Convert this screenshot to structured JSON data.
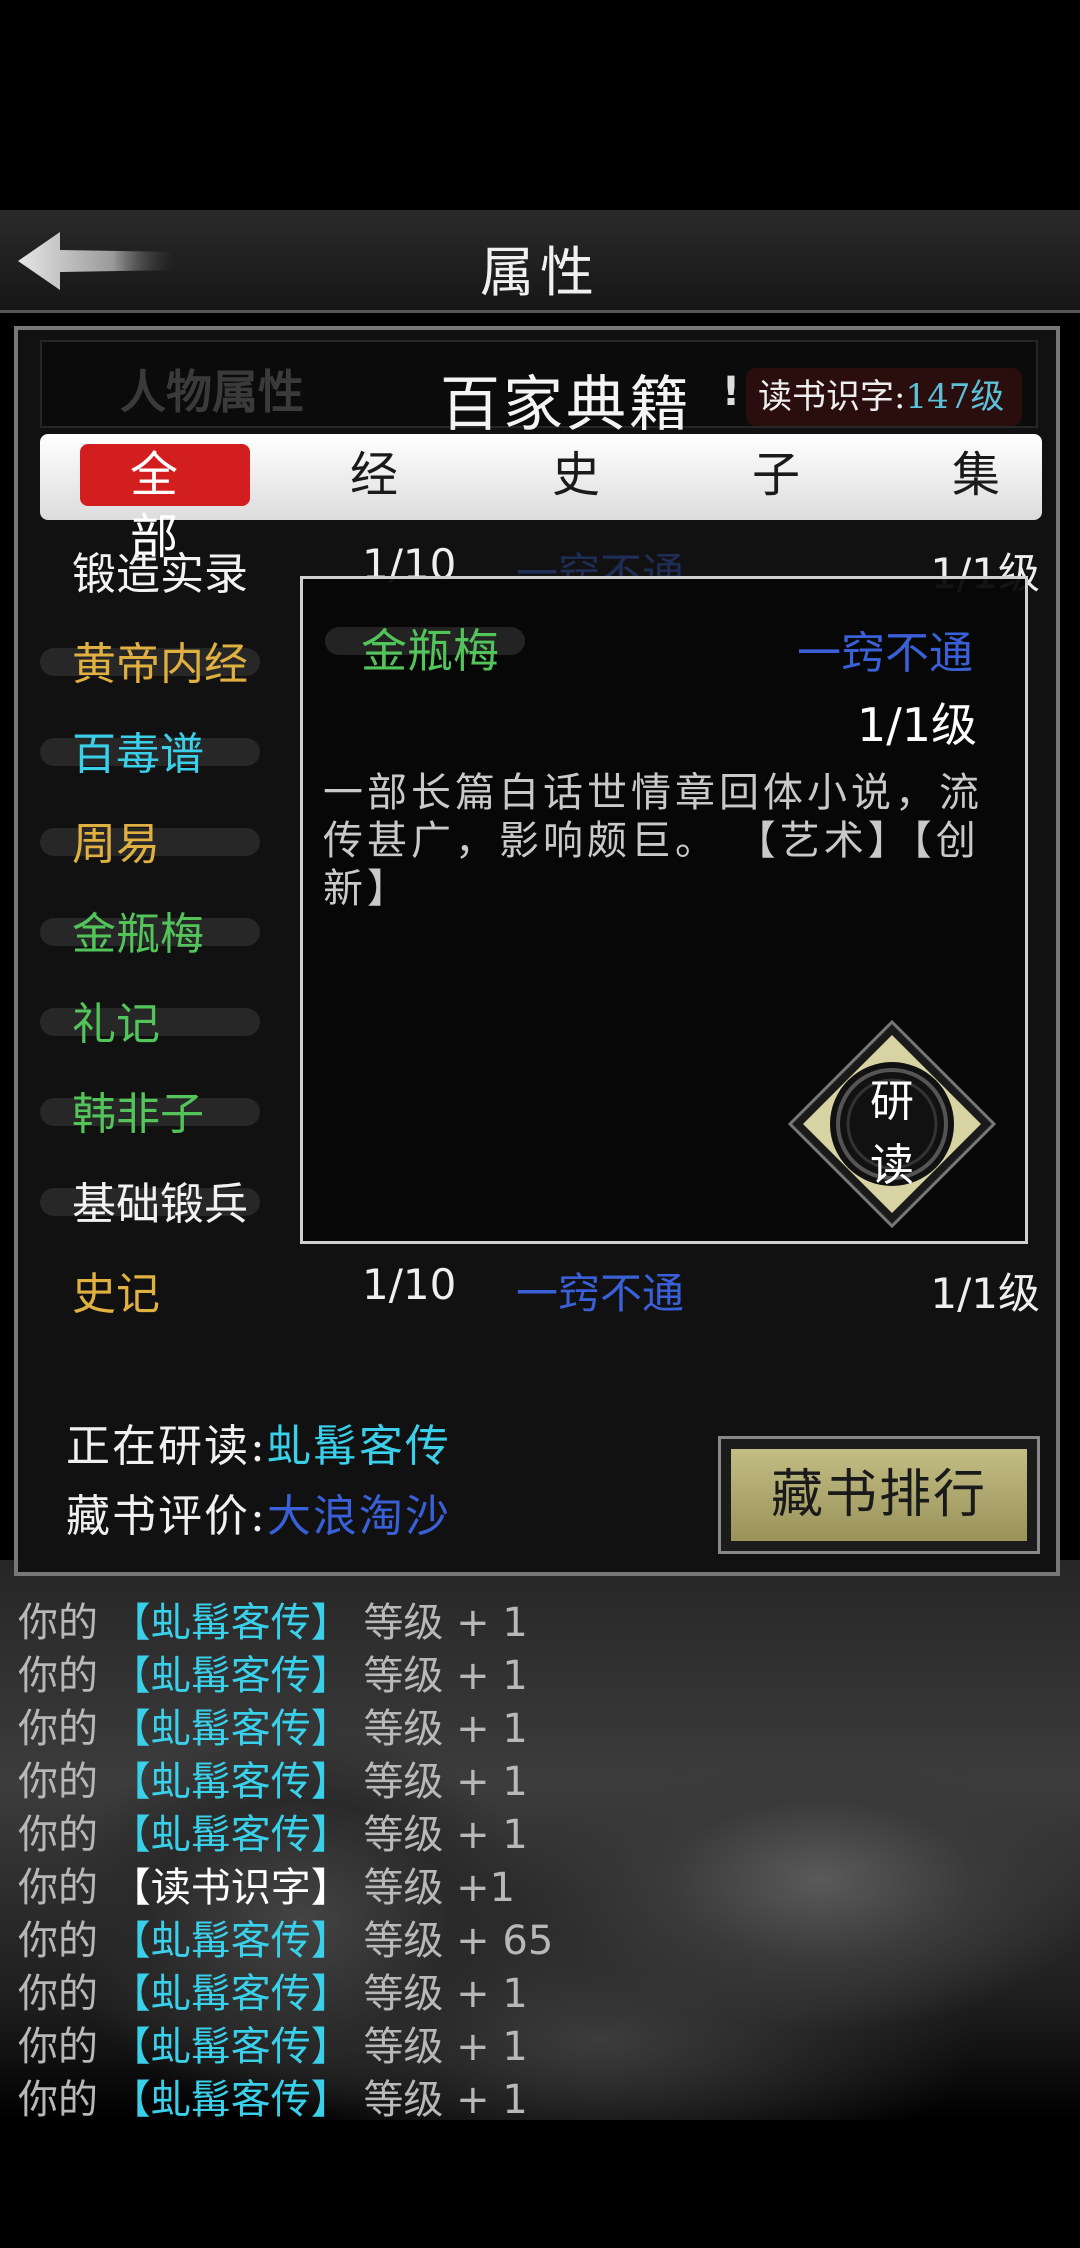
{
  "header": {
    "title": "属性",
    "back_icon": "back-arrow-icon"
  },
  "panel": {
    "bg_tab_label": "人物属性",
    "title": "百家典籍",
    "exclaim": "!",
    "reading_skill_label": "读书识字:",
    "reading_skill_value": "147级"
  },
  "tabs": [
    {
      "label": "全部",
      "active": true
    },
    {
      "label": "经"
    },
    {
      "label": "史"
    },
    {
      "label": "子"
    },
    {
      "label": "集"
    }
  ],
  "books": [
    {
      "name": "锻造实录",
      "color": "#f2f2f2",
      "progress": "1/10",
      "mastery": "一窍不通",
      "level": "1/1级"
    },
    {
      "name": "黄帝内经",
      "color": "#e0b040",
      "progress": "",
      "mastery": "",
      "level": ""
    },
    {
      "name": "百毒谱",
      "color": "#3ad0ea",
      "progress": "",
      "mastery": "",
      "level": ""
    },
    {
      "name": "周易",
      "color": "#e0b040",
      "progress": "",
      "mastery": "",
      "level": ""
    },
    {
      "name": "金瓶梅",
      "color": "#52c45a",
      "progress": "",
      "mastery": "",
      "level": ""
    },
    {
      "name": "礼记",
      "color": "#52c45a",
      "progress": "",
      "mastery": "",
      "level": ""
    },
    {
      "name": "韩非子",
      "color": "#52c45a",
      "progress": "",
      "mastery": "",
      "level": ""
    },
    {
      "name": "基础锻兵",
      "color": "#f2f2f2",
      "progress": "",
      "mastery": "",
      "level": ""
    },
    {
      "name": "史记",
      "color": "#e0b040",
      "progress": "1/10",
      "mastery": "一窍不通",
      "level": "1/1级"
    }
  ],
  "popup": {
    "name": "金瓶梅",
    "mastery": "一窍不通",
    "level": "1/1级",
    "description": "一部长篇白话世情章回体小说，流传甚广，影响颇巨。  【艺术】【创新】",
    "study_button_line1": "研",
    "study_button_line2": "读"
  },
  "status": {
    "studying_label": "正在研读:",
    "studying_value": "虬髯客传",
    "rating_label": "藏书评价:",
    "rating_value": "大浪淘沙"
  },
  "rank_button": "藏书排行",
  "log": [
    {
      "prefix": "你的",
      "book": "【虬髯客传】",
      "suffix": "等级 + 1"
    },
    {
      "prefix": "你的",
      "book": "【虬髯客传】",
      "suffix": "等级 + 1"
    },
    {
      "prefix": "你的",
      "book": "【虬髯客传】",
      "suffix": "等级 + 1"
    },
    {
      "prefix": "你的",
      "book": "【虬髯客传】",
      "suffix": "等级 + 1"
    },
    {
      "prefix": "你的",
      "book": "【虬髯客传】",
      "suffix": "等级 + 1"
    },
    {
      "prefix": "你的",
      "book": "【读书识字】",
      "suffix": "等级 +1"
    },
    {
      "prefix": "你的",
      "book": "【虬髯客传】",
      "suffix": "等级 + 65"
    },
    {
      "prefix": "你的",
      "book": "【虬髯客传】",
      "suffix": "等级 + 1"
    },
    {
      "prefix": "你的",
      "book": "【虬髯客传】",
      "suffix": "等级 + 1"
    },
    {
      "prefix": "你的",
      "book": "【虬髯客传】",
      "suffix": "等级 + 1"
    }
  ]
}
